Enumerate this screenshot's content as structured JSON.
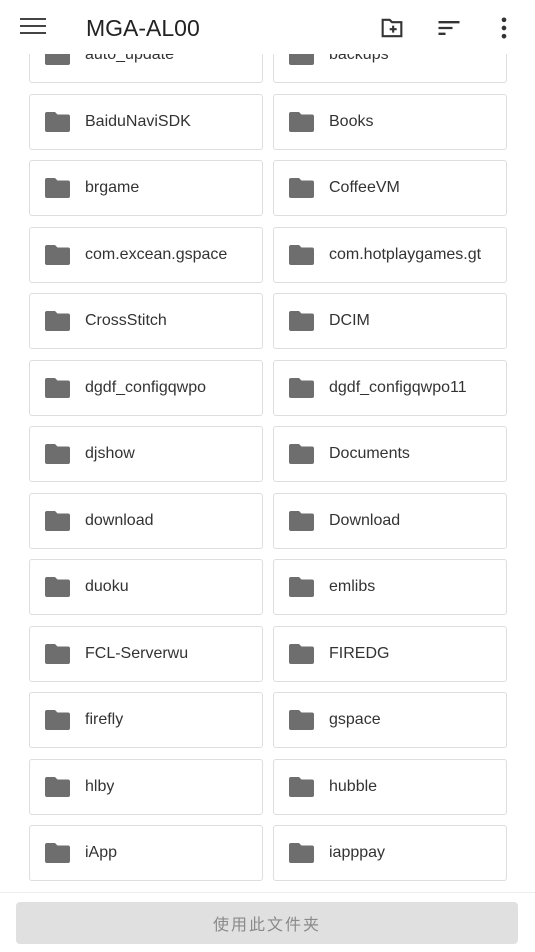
{
  "appbar": {
    "title": "MGA-AL00",
    "icons": [
      "menu-icon",
      "new-folder-icon",
      "sort-icon",
      "more-vert-icon"
    ]
  },
  "folders": [
    "auto_update",
    "backups",
    "BaiduNaviSDK",
    "Books",
    "brgame",
    "CoffeeVM",
    "com.excean.gspace",
    "com.hotplaygames.gt",
    "CrossStitch",
    "DCIM",
    "dgdf_configqwpo",
    "dgdf_configqwpo11",
    "djshow",
    "Documents",
    "download",
    "Download",
    "duoku",
    "emlibs",
    "FCL-Serverwu",
    "FIREDG",
    "firefly",
    "gspace",
    "hlby",
    "hubble",
    "iApp",
    "iapppay",
    "",
    ""
  ],
  "bottom": {
    "use_folder_label": "使用此文件夹"
  },
  "colors": {
    "folder_icon": "#6e6e6e",
    "button_bg": "#e0e0e0"
  }
}
